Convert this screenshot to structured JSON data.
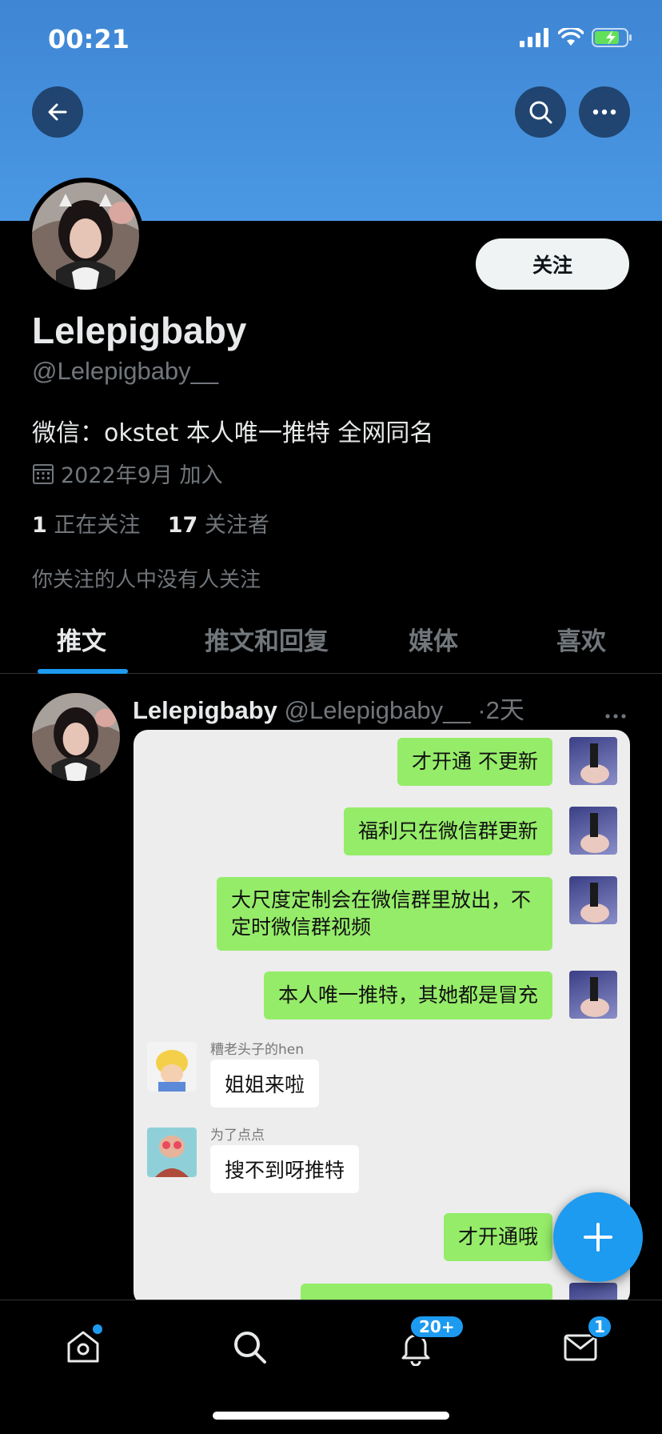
{
  "status_bar": {
    "time": "00:21"
  },
  "profile": {
    "follow_label": "关注",
    "display_name": "Lelepigbaby",
    "handle": "@Lelepigbaby__",
    "bio": "微信：okstet 本人唯一推特 全网同名",
    "joined": "2022年9月 加入",
    "following_count": "1",
    "following_label": "正在关注",
    "followers_count": "17",
    "followers_label": "关注者",
    "mutual_note": "你关注的人中没有人关注"
  },
  "tabs": [
    {
      "label": "推文",
      "active": true
    },
    {
      "label": "推文和回复",
      "active": false
    },
    {
      "label": "媒体",
      "active": false
    },
    {
      "label": "喜欢",
      "active": false
    }
  ],
  "tweet": {
    "author_name": "Lelepigbaby",
    "author_handle": "@Lelepigbaby__",
    "separator": "·",
    "time": "2天",
    "chat": {
      "messages": [
        {
          "side": "right",
          "text": "才开通 不更新"
        },
        {
          "side": "right",
          "text": "福利只在微信群更新"
        },
        {
          "side": "right",
          "text": "大尺度定制会在微信群里放出，不定时微信群视频"
        },
        {
          "side": "right",
          "text": "本人唯一推特，其她都是冒充"
        },
        {
          "side": "left",
          "sender": "糟老头子的hen",
          "text": "姐姐来啦"
        },
        {
          "side": "left",
          "sender": "为了点点",
          "text": "搜不到呀推特"
        },
        {
          "side": "right",
          "text": "才开通哦"
        }
      ]
    }
  },
  "bottom_nav": {
    "notifications_badge": "20+",
    "messages_badge": "1"
  },
  "colors": {
    "accent": "#1d9bf0",
    "banner": "#4a98e4",
    "chat_green": "#95ec69"
  }
}
